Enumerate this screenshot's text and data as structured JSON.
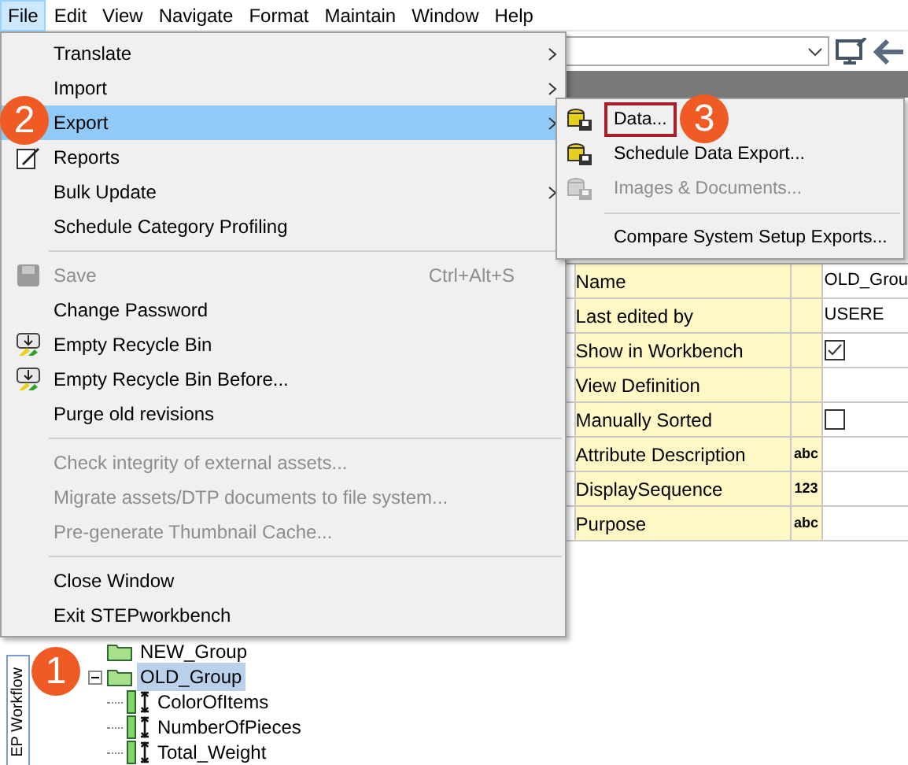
{
  "menu_bar": [
    {
      "label": "File",
      "selected": true
    },
    {
      "label": "Edit",
      "selected": false
    },
    {
      "label": "View",
      "selected": false
    },
    {
      "label": "Navigate",
      "selected": false
    },
    {
      "label": "Format",
      "selected": false
    },
    {
      "label": "Maintain",
      "selected": false
    },
    {
      "label": "Window",
      "selected": false
    },
    {
      "label": "Help",
      "selected": false
    }
  ],
  "file_menu": [
    {
      "kind": "plain",
      "label": "Translate",
      "submenu": true,
      "disabled": false,
      "selected": false
    },
    {
      "kind": "plain",
      "label": "Import",
      "submenu": true,
      "disabled": false,
      "selected": false
    },
    {
      "kind": "plain",
      "label": "Export",
      "submenu": true,
      "disabled": false,
      "selected": true
    },
    {
      "kind": "report",
      "label": "Reports",
      "disabled": false,
      "selected": false
    },
    {
      "kind": "plain",
      "label": "Bulk Update",
      "submenu": true,
      "disabled": false,
      "selected": false
    },
    {
      "kind": "plain",
      "label": "Schedule Category Profiling",
      "disabled": false,
      "selected": false
    },
    {
      "kind": "separator"
    },
    {
      "kind": "save",
      "label": "Save",
      "shortcut": "Ctrl+Alt+S",
      "disabled": true,
      "selected": false
    },
    {
      "kind": "plain",
      "label": "Change Password",
      "disabled": false,
      "selected": false
    },
    {
      "kind": "recycle",
      "label": "Empty Recycle Bin",
      "disabled": false,
      "selected": false
    },
    {
      "kind": "recycle",
      "label": "Empty Recycle Bin Before...",
      "disabled": false,
      "selected": false
    },
    {
      "kind": "plain",
      "label": "Purge old revisions",
      "disabled": false,
      "selected": false
    },
    {
      "kind": "separator"
    },
    {
      "kind": "plain",
      "label": "Check integrity of external assets...",
      "disabled": true,
      "selected": false
    },
    {
      "kind": "plain",
      "label": "Migrate assets/DTP documents to file system...",
      "disabled": true,
      "selected": false
    },
    {
      "kind": "plain",
      "label": "Pre-generate Thumbnail Cache...",
      "disabled": true,
      "selected": false
    },
    {
      "kind": "separator"
    },
    {
      "kind": "plain",
      "label": "Close Window",
      "disabled": false,
      "selected": false
    },
    {
      "kind": "plain",
      "label": "Exit STEPworkbench",
      "disabled": false,
      "selected": false
    }
  ],
  "export_submenu": [
    {
      "kind": "export",
      "label": "Data...",
      "disabled": false,
      "highlighted": true
    },
    {
      "kind": "export",
      "label": "Schedule Data Export...",
      "disabled": false,
      "highlighted": false
    },
    {
      "kind": "export",
      "label": "Images & Documents...",
      "disabled": true,
      "highlighted": false
    },
    {
      "kind": "separator"
    },
    {
      "kind": "plain",
      "label": "Compare System Setup Exports...",
      "disabled": false,
      "highlighted": false
    }
  ],
  "side_tab": {
    "label": "EP Workflow"
  },
  "tree": [
    {
      "label": "NEW_Group",
      "selected": false
    },
    {
      "label": "OLD_Group",
      "selected": true,
      "expanded": true,
      "children": [
        {
          "label": "ColorOfItems"
        },
        {
          "label": "NumberOfPieces"
        },
        {
          "label": "Total_Weight"
        }
      ]
    }
  ],
  "properties": [
    {
      "kind": "text",
      "label": "Name",
      "value": "OLD_Grou"
    },
    {
      "kind": "text",
      "label": "Last edited by",
      "value": "USERE"
    },
    {
      "kind": "checkbox",
      "label": "Show in Workbench",
      "checked": true
    },
    {
      "kind": "text",
      "label": "View Definition"
    },
    {
      "kind": "checkbox",
      "label": "Manually Sorted",
      "checked": false
    },
    {
      "kind": "text",
      "label": "Attribute Description",
      "type": "abc"
    },
    {
      "kind": "text",
      "label": "DisplaySequence",
      "type": "123"
    },
    {
      "kind": "text",
      "label": "Purpose",
      "type": "abc"
    }
  ],
  "annotations": [
    {
      "label": "1"
    },
    {
      "label": "2"
    },
    {
      "label": "3"
    }
  ]
}
